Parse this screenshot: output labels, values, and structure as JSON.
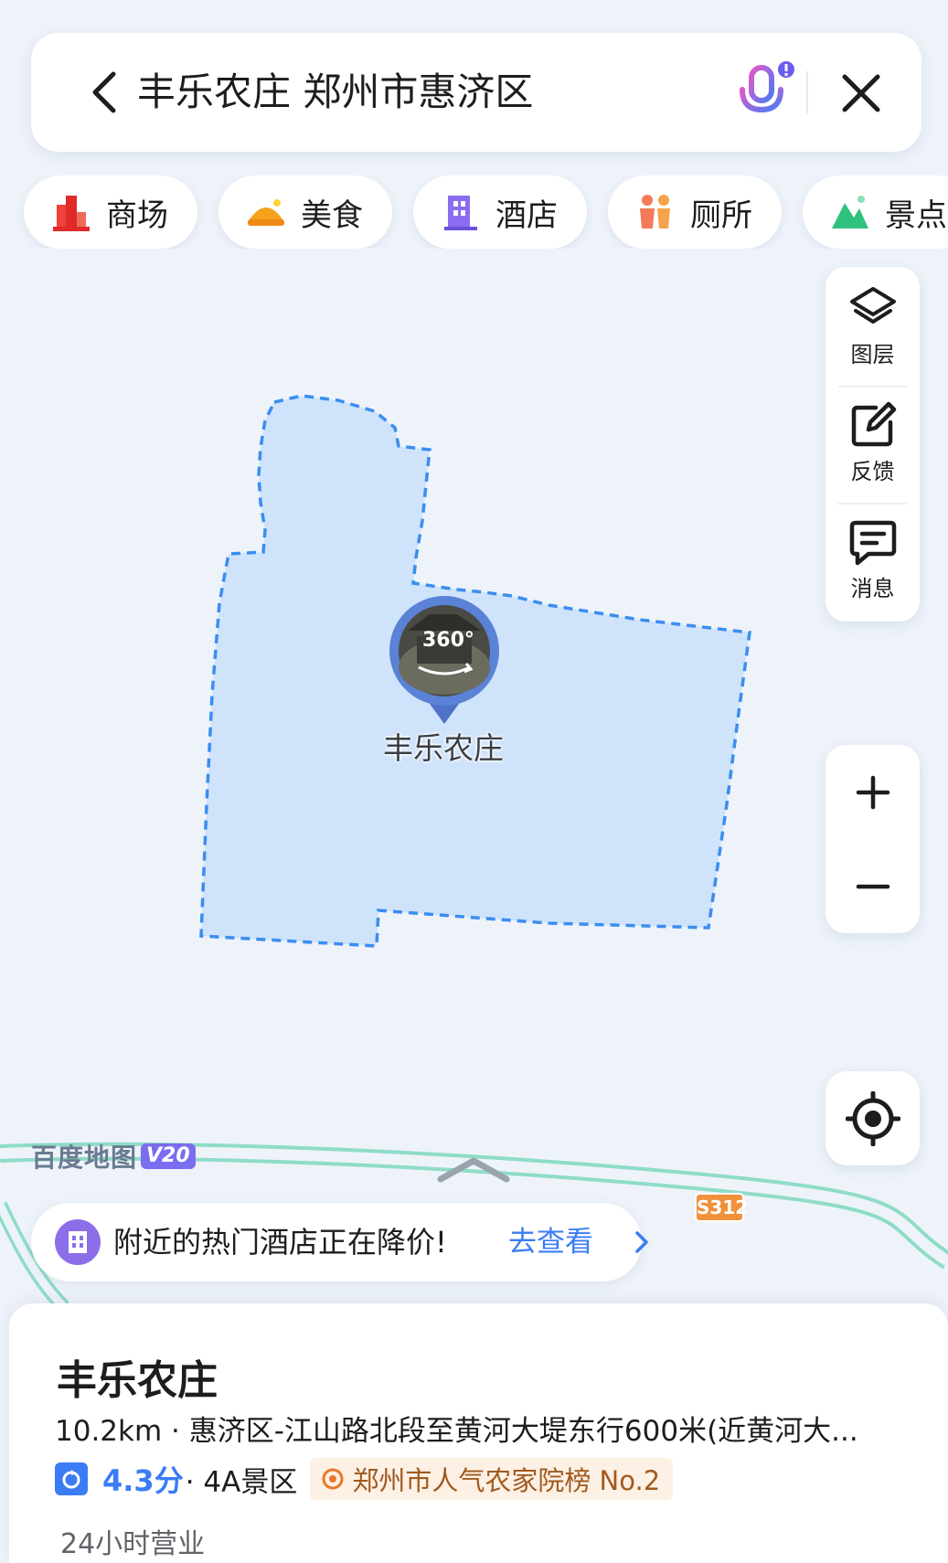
{
  "search": {
    "query": "丰乐农庄 郑州市惠济区",
    "back_icon": "chevron-left-icon",
    "mic_icon": "microphone-icon",
    "close_icon": "close-icon"
  },
  "categories": [
    {
      "label": "商场",
      "icon": "mall-icon",
      "color": "#f0413b"
    },
    {
      "label": "美食",
      "icon": "food-icon",
      "color": "#f6a21e"
    },
    {
      "label": "酒店",
      "icon": "hotel-icon",
      "color": "#8a6cf0"
    },
    {
      "label": "厕所",
      "icon": "toilet-icon",
      "color": "#f0a05a"
    },
    {
      "label": "景点",
      "icon": "scenic-icon",
      "color": "#2ec27e"
    }
  ],
  "tools": {
    "layers": "图层",
    "feedback": "反馈",
    "messages": "消息"
  },
  "map": {
    "poi_label": "丰乐农庄",
    "badge_360": "360°",
    "road_shield": "S312",
    "area_color": "#cfe3fb",
    "area_border": "#3a8ef0",
    "road_color": "#8fdcc6"
  },
  "logo": {
    "text": "百度地图",
    "version": "V20"
  },
  "banner": {
    "text": "附近的热门酒店正在降价!",
    "link": "去查看"
  },
  "poi": {
    "title": "丰乐农庄",
    "address": "10.2km · 惠济区-江山路北段至黄河大堤东行600米(近黄河大...",
    "rating": "4.3分",
    "category": "· 4A景区",
    "rank": "郑州市人气农家院榜 No.2",
    "hours": "24小时营业"
  },
  "colors": {
    "accent": "#3b7cf5",
    "background": "#eef3fa"
  }
}
